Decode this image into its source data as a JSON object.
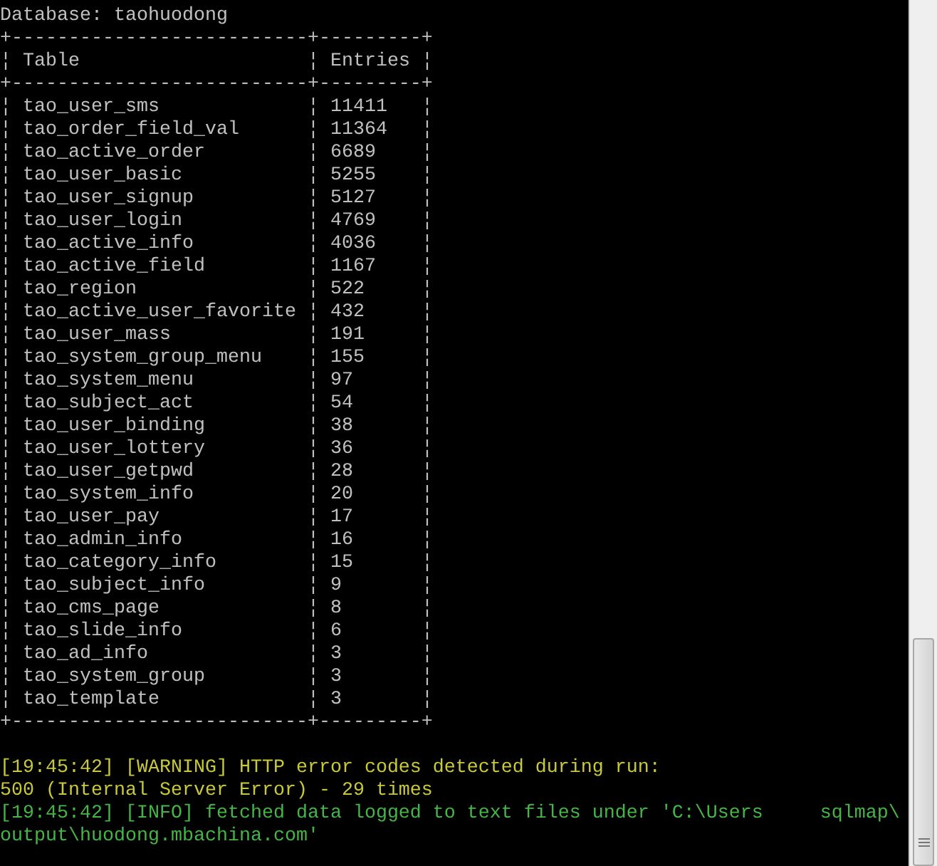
{
  "heading": "Database: taohuodong",
  "table": {
    "border": "+--------------------------+---------+",
    "separator": "¦",
    "columns": [
      "Table",
      "Entries"
    ],
    "rows": [
      [
        "tao_user_sms",
        "11411"
      ],
      [
        "tao_order_field_val",
        "11364"
      ],
      [
        "tao_active_order",
        "6689"
      ],
      [
        "tao_user_basic",
        "5255"
      ],
      [
        "tao_user_signup",
        "5127"
      ],
      [
        "tao_user_login",
        "4769"
      ],
      [
        "tao_active_info",
        "4036"
      ],
      [
        "tao_active_field",
        "1167"
      ],
      [
        "tao_region",
        "522"
      ],
      [
        "tao_active_user_favorite",
        "432"
      ],
      [
        "tao_user_mass",
        "191"
      ],
      [
        "tao_system_group_menu",
        "155"
      ],
      [
        "tao_system_menu",
        "97"
      ],
      [
        "tao_subject_act",
        "54"
      ],
      [
        "tao_user_binding",
        "38"
      ],
      [
        "tao_user_lottery",
        "36"
      ],
      [
        "tao_user_getpwd",
        "28"
      ],
      [
        "tao_system_info",
        "20"
      ],
      [
        "tao_user_pay",
        "17"
      ],
      [
        "tao_admin_info",
        "16"
      ],
      [
        "tao_category_info",
        "15"
      ],
      [
        "tao_subject_info",
        "9"
      ],
      [
        "tao_cms_page",
        "8"
      ],
      [
        "tao_slide_info",
        "6"
      ],
      [
        "tao_ad_info",
        "3"
      ],
      [
        "tao_system_group",
        "3"
      ],
      [
        "tao_template",
        "3"
      ]
    ]
  },
  "log": [
    {
      "kind": "warning",
      "segments": [
        "[19:45:42] [WARNING] HTTP error codes detected during run:"
      ]
    },
    {
      "kind": "warning",
      "segments": [
        "500 (Internal Server Error) - 29 times"
      ]
    },
    {
      "kind": "info",
      "segments": [
        "[19:45:42] [INFO] fetched data logged to text files under 'C:\\Users",
        "sqlmap\\"
      ]
    },
    {
      "kind": "info",
      "segments": [
        "output\\huodong.mbachina.com'"
      ]
    }
  ]
}
